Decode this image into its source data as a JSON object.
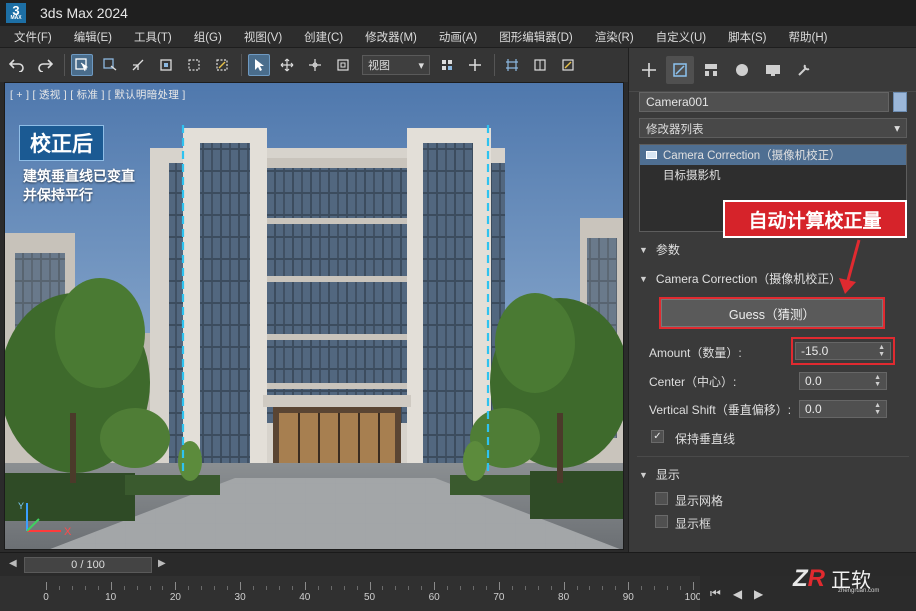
{
  "app": {
    "logo_text": "3",
    "logo_sub": "MAX",
    "title": "3ds Max 2024"
  },
  "menu": [
    "文件(F)",
    "编辑(E)",
    "工具(T)",
    "组(G)",
    "视图(V)",
    "创建(C)",
    "修改器(M)",
    "动画(A)",
    "图形编辑器(D)",
    "渲染(R)",
    "自定义(U)",
    "脚本(S)",
    "帮助(H)"
  ],
  "toolbar": {
    "view_select": "视图"
  },
  "viewport": {
    "label": "[ + ] [ 透视 ] [ 标准 ] [ 默认明暗处理 ]",
    "badge": "校正后",
    "desc_line1": "建筑垂直线已变直",
    "desc_line2": "并保持平行",
    "axis_x": "X",
    "axis_y": "Y"
  },
  "panel": {
    "object_name": "Camera001",
    "object_color": "#9bb7d9",
    "modifier_list": "修改器列表",
    "stack": [
      "Camera Correction（摄像机校正）",
      "目标摄影机"
    ],
    "callout": "自动计算校正量",
    "params_title": "参数",
    "cc_title": "Camera Correction（摄像机校正）",
    "guess_label": "Guess（猜测）",
    "amount_label": "Amount（数量）:",
    "amount_value": "-15.0",
    "center_label": "Center（中心）:",
    "center_value": "0.0",
    "vshift_label": "Vertical Shift（垂直偏移）:",
    "vshift_value": "0.0",
    "keep_vertical": "保持垂直线",
    "display_title": "显示",
    "show_grid": "显示网格",
    "show_frame": "显示框"
  },
  "timeline": {
    "slider": "0 / 100",
    "ticks": [
      "0",
      "10",
      "20",
      "30",
      "40",
      "50",
      "60",
      "70",
      "80",
      "90",
      "100"
    ]
  },
  "watermark": {
    "logo_a": "Z",
    "logo_b": "R",
    "text": "正软",
    "url": "zhengruan.com"
  },
  "colors": {
    "accent_red": "#e02a30",
    "selection_blue": "#4f6f92",
    "badge_blue": "#1b5a93"
  }
}
